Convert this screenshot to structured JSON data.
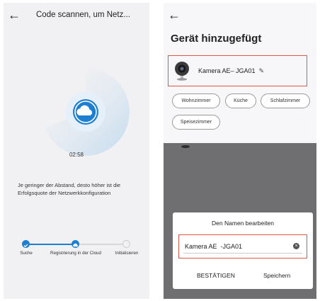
{
  "left": {
    "title": "Code scannen, um Netz...",
    "timer": "02:58",
    "hint": "Je geringer der Abstand, desto höher ist die Erfolgsquote der Netzwerkkonfiguration",
    "steps": [
      {
        "label": "Suche",
        "state": "done"
      },
      {
        "label": "Registrierung in der Cloud",
        "state": "active"
      },
      {
        "label": "Initialisieren",
        "state": "pending"
      }
    ]
  },
  "right": {
    "title": "Gerät hinzugefügt",
    "device_name": "Kamera AE– JGA01",
    "rooms": [
      "Wohnzimmer",
      "Küche",
      "Schlafzimmer",
      "Speisezimmer"
    ],
    "dialog": {
      "title": "Den Namen bearbeiten",
      "input_value": "Kamera AE  -JGA01",
      "confirm_label": "BESTÄTIGEN",
      "save_label": "Speichern"
    }
  },
  "colors": {
    "accent": "#1e7fd0",
    "highlight_border": "#e0544c",
    "overlay": "#6f6f71"
  }
}
